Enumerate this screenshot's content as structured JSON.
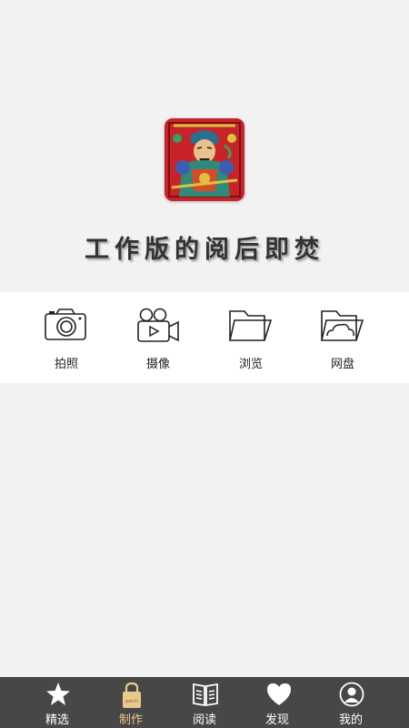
{
  "app_title": "工作版的阅后即焚",
  "logo": {
    "icon": "door-god-painting",
    "colors": {
      "background": "#c9232a",
      "face": "#e8c28a"
    }
  },
  "actions": [
    {
      "id": "camera",
      "label": "拍照",
      "icon": "camera-icon"
    },
    {
      "id": "video",
      "label": "摄像",
      "icon": "video-camera-icon"
    },
    {
      "id": "browse",
      "label": "浏览",
      "icon": "folder-icon"
    },
    {
      "id": "cloud",
      "label": "网盘",
      "icon": "cloud-folder-icon"
    }
  ],
  "tabbar": {
    "tabs": [
      {
        "id": "featured",
        "label": "精选",
        "icon": "star-icon",
        "active": false
      },
      {
        "id": "create",
        "label": "制作",
        "icon": "lock-icon",
        "active": true
      },
      {
        "id": "read",
        "label": "阅读",
        "icon": "book-icon",
        "active": false
      },
      {
        "id": "discover",
        "label": "发现",
        "icon": "heart-icon",
        "active": false
      },
      {
        "id": "mine",
        "label": "我的",
        "icon": "user-icon",
        "active": false
      }
    ],
    "colors": {
      "background": "#474747",
      "active": "#e9c98d",
      "inactive": "#ffffff"
    }
  }
}
